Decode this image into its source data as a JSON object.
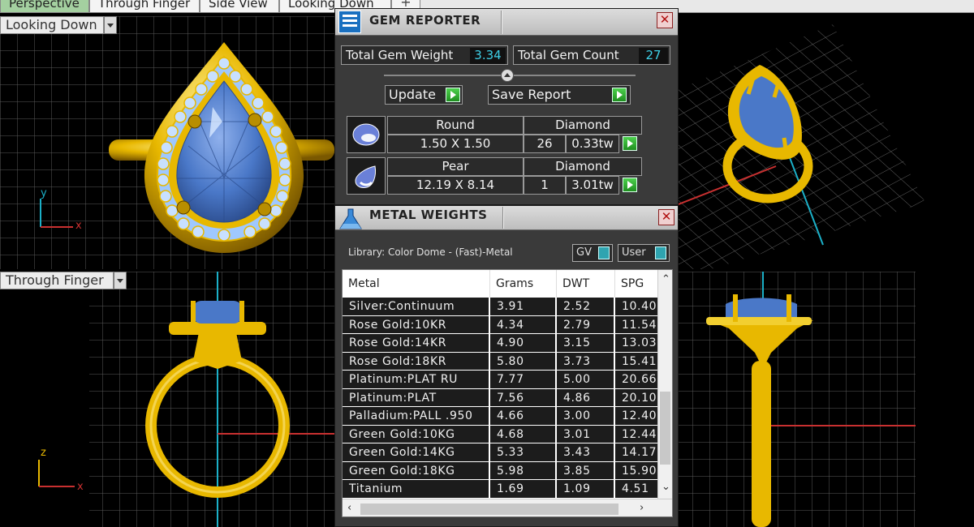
{
  "tabs": [
    {
      "label": "Perspective"
    },
    {
      "label": "Through Finger"
    },
    {
      "label": "Side View"
    },
    {
      "label": "Looking Down"
    }
  ],
  "tab_add": "+",
  "viewports": {
    "top_left": {
      "label": "Looking Down",
      "axis_v": "y",
      "axis_h": "x"
    },
    "bottom_left": {
      "label": "Through Finger",
      "axis_v": "z",
      "axis_h": "x"
    }
  },
  "gem_reporter": {
    "title": "GEM REPORTER",
    "close": "✕",
    "total_weight_label": "Total Gem Weight",
    "total_weight_value": "3.34",
    "total_count_label": "Total Gem Count",
    "total_count_value": "27",
    "update_label": "Update",
    "save_label": "Save Report",
    "gems": [
      {
        "shape": "Round",
        "size": "1.50 X 1.50",
        "material": "Diamond",
        "count": "26",
        "carats": "0.33tw"
      },
      {
        "shape": "Pear",
        "size": "12.19 X 8.14",
        "material": "Diamond",
        "count": "1",
        "carats": "3.01tw"
      }
    ]
  },
  "metal_weights": {
    "title": "METAL WEIGHTS",
    "close": "✕",
    "library": "Library: Color Dome - (Fast)-Metal",
    "gv_label": "GV",
    "user_label": "User",
    "columns": [
      "Metal",
      "Grams",
      "DWT",
      "SPG"
    ],
    "rows": [
      [
        "Silver:Continuum",
        "3.91",
        "2.52",
        "10.40"
      ],
      [
        "Rose Gold:10KR",
        "4.34",
        "2.79",
        "11.54"
      ],
      [
        "Rose Gold:14KR",
        "4.90",
        "3.15",
        "13.03"
      ],
      [
        "Rose Gold:18KR",
        "5.80",
        "3.73",
        "15.41"
      ],
      [
        "Platinum:PLAT RU",
        "7.77",
        "5.00",
        "20.66"
      ],
      [
        "Platinum:PLAT",
        "7.56",
        "4.86",
        "20.10"
      ],
      [
        "Palladium:PALL .950",
        "4.66",
        "3.00",
        "12.40"
      ],
      [
        "Green Gold:10KG",
        "4.68",
        "3.01",
        "12.44"
      ],
      [
        "Green Gold:14KG",
        "5.33",
        "3.43",
        "14.17"
      ],
      [
        "Green Gold:18KG",
        "5.98",
        "3.85",
        "15.90"
      ],
      [
        "Titanium",
        "1.69",
        "1.09",
        "4.51"
      ]
    ]
  },
  "colors": {
    "gold": "#e8b800",
    "gem_blue": "#4a78c8",
    "grid": "#5a5a5a",
    "accent_cyan": "#3ed0e8",
    "go_green": "#2fb02f"
  }
}
